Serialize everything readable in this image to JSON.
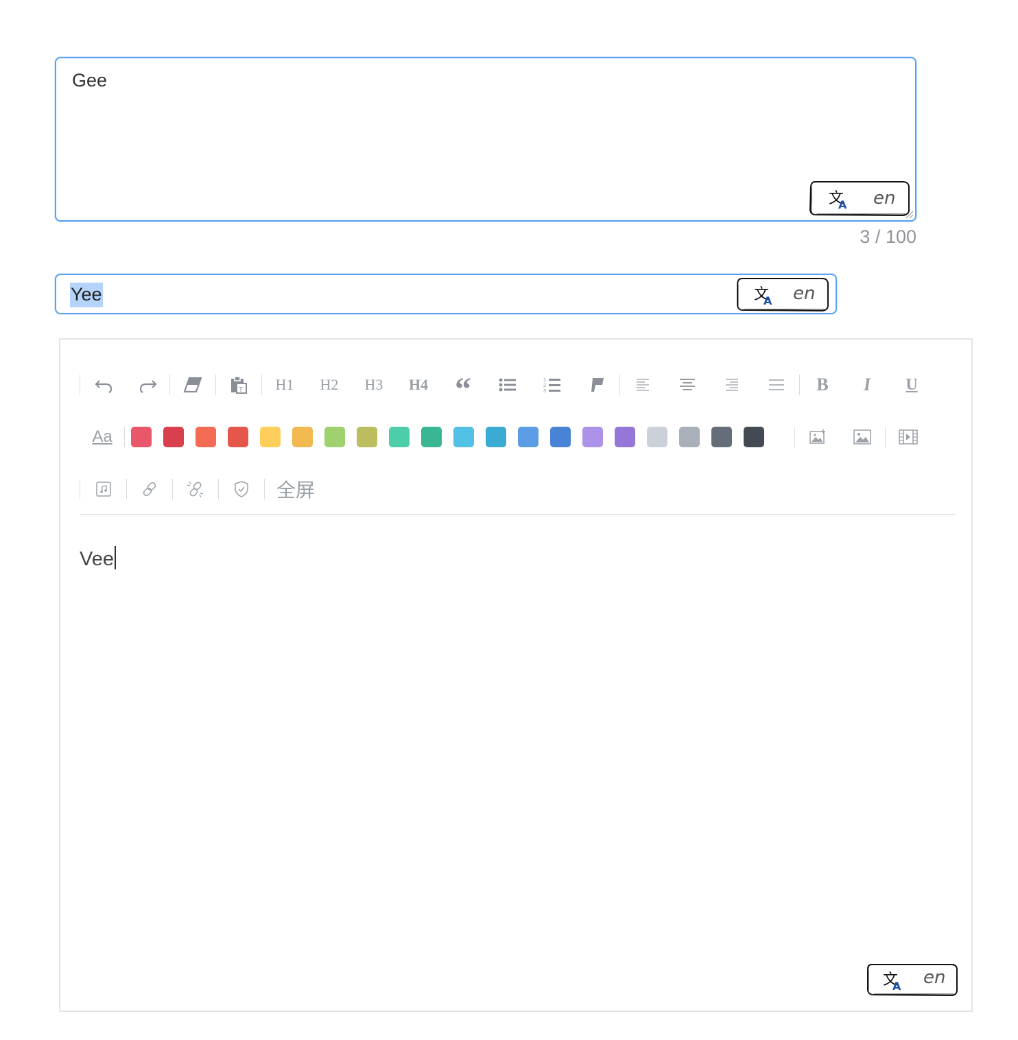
{
  "textarea": {
    "value": "Gee",
    "counter": "3 / 100"
  },
  "input": {
    "value": "Yee"
  },
  "translate_button": {
    "lang": "en"
  },
  "editor": {
    "content": "Vee",
    "toolbar": {
      "h1": "H1",
      "h2": "H2",
      "h3": "H3",
      "h4": "H4",
      "bold": "B",
      "italic": "I",
      "underline": "U",
      "font_size": "Aa",
      "fullscreen": "全屏",
      "icons": [
        "undo-icon",
        "redo-icon",
        "eraser-icon",
        "paste-text-icon",
        "quote-icon",
        "bullet-list-icon",
        "ordered-list-icon",
        "code-block-icon",
        "align-left-icon",
        "align-center-icon",
        "align-right-icon",
        "align-justify-icon",
        "upload-image-icon",
        "image-icon",
        "video-icon",
        "audio-icon",
        "link-icon",
        "unlink-icon",
        "shield-icon"
      ]
    },
    "colors": [
      "#e8586a",
      "#d9404e",
      "#f26b52",
      "#e4574a",
      "#fdce5c",
      "#f1b94f",
      "#9fd26f",
      "#bcbd5f",
      "#4ecda9",
      "#3bb692",
      "#53c1e5",
      "#3cabd4",
      "#5b9ce5",
      "#4883d6",
      "#ad92ea",
      "#9477d8",
      "#ccd1d9",
      "#a9b0ba",
      "#656d78",
      "#434a54"
    ]
  }
}
